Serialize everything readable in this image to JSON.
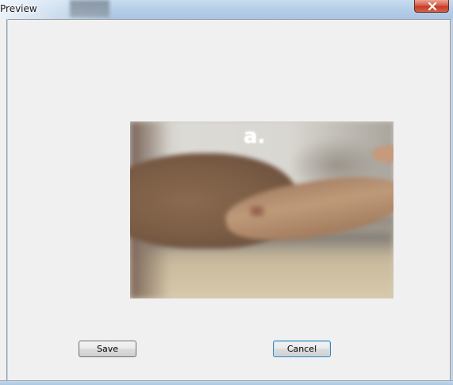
{
  "window": {
    "title": "Preview"
  },
  "preview": {
    "photo_label": "a."
  },
  "actions": {
    "save_label": "Save",
    "cancel_label": "Cancel"
  },
  "colors": {
    "client_background": "#f0f0f0",
    "close_button": "#c63a24",
    "default_button_border": "#3c7fb1"
  },
  "icons": {
    "close": "close-icon"
  }
}
